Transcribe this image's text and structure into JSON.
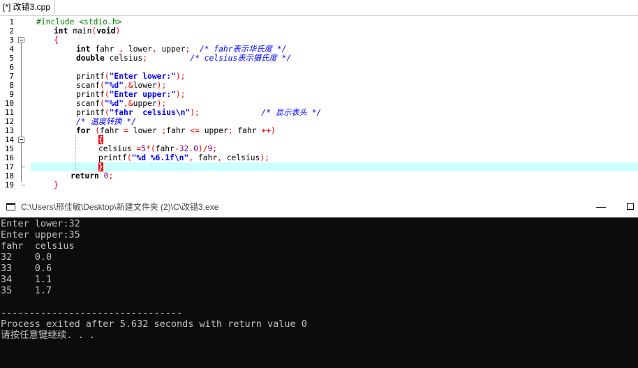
{
  "editor": {
    "tab_label": "[*] 改错3.cpp",
    "line_numbers": [
      "1",
      "2",
      "3",
      "4",
      "5",
      "6",
      "7",
      "8",
      "9",
      "10",
      "11",
      "12",
      "13",
      "14",
      "15",
      "16",
      "17",
      "18",
      "19"
    ],
    "code": {
      "l1": "#include <stdio.h>",
      "l2_kw": "int",
      "l2_rest": " main",
      "l2_p1": "(",
      "l2_void": "void",
      "l2_p2": ")",
      "l3": "{",
      "l4_kw": "int",
      "l4_rest": " fahr ",
      "l4_c1": ",",
      "l4_mid": " lower",
      "l4_c2": ",",
      "l4_end": " upper",
      "l4_semi": ";",
      "l4_comment": "  /* fahr表示华氏度 */",
      "l5_kw": "double",
      "l5_rest": " celsius",
      "l5_semi": ";",
      "l5_comment": "         /* celsius表示摄氏度 */",
      "l7_fn": "printf",
      "l7_p1": "(",
      "l7_str": "\"Enter lower:\"",
      "l7_p2": ");",
      "l8_fn": "scanf",
      "l8_p1": "(",
      "l8_str": "\"%d\"",
      "l8_rest": ",&",
      "l8_var": "lower",
      "l8_p2": ");",
      "l9_fn": "printf",
      "l9_p1": "(",
      "l9_str": "\"Enter upper:\"",
      "l9_p2": ");",
      "l10_fn": "scanf",
      "l10_p1": "(",
      "l10_str": "\"%d\"",
      "l10_rest": ",&",
      "l10_var": "upper",
      "l10_p2": ");",
      "l11_fn": "printf",
      "l11_p1": "(",
      "l11_str": "\"fahr  celsius\\n\"",
      "l11_p2": ");",
      "l11_comment": "             /* 显示表头 */",
      "l12_comment": "/* 温度转换 */",
      "l13_kw": "for",
      "l13_p1": " (",
      "l13_a": "fahr ",
      "l13_eq": "=",
      "l13_b": " lower ",
      "l13_s1": ";",
      "l13_c": "fahr ",
      "l13_le": "<=",
      "l13_d": " upper",
      "l13_s2": ";",
      "l13_e": " fahr ",
      "l13_pp": "++",
      "l13_p2": ")",
      "l14": "{",
      "l15_a": "celsius ",
      "l15_eq": "=",
      "l15_five": "5",
      "l15_mul": "*",
      "l15_p1": "(",
      "l15_b": "fahr",
      "l15_minus": "-",
      "l15_num": "32.0",
      "l15_p2": ")",
      "l15_div": "/",
      "l15_nine": "9",
      "l15_semi": ";",
      "l16_fn": "printf",
      "l16_p1": "(",
      "l16_str": "\"%d %6.1f\\n\"",
      "l16_c1": ",",
      "l16_a": " fahr",
      "l16_c2": ",",
      "l16_b": " celsius",
      "l16_p2": ");",
      "l17": "}",
      "l18_kw": "return",
      "l18_sp": " ",
      "l18_num": "0",
      "l18_semi": ";",
      "l19": "}"
    }
  },
  "console": {
    "title": "C:\\Users\\邢佳敏\\Desktop\\新建文件夹 (2)\\C\\改错3.exe",
    "minimize_glyph": "—",
    "lines": [
      "Enter lower:32",
      "Enter upper:35",
      "fahr  celsius",
      "32    0.0",
      "33    0.6",
      "34    1.1",
      "35    1.7",
      "",
      "--------------------------------",
      "Process exited after 5.632 seconds with return value 0",
      "请按任意键继续. . ."
    ]
  },
  "colors": {
    "keyword": "#000000",
    "comment": "#0000ff",
    "string": "#0000ff",
    "number": "#800080",
    "operator": "#ff0000",
    "preprocessor": "#008000",
    "current_line": "#ccffff",
    "console_bg": "#0c0c0c",
    "console_fg": "#c0c0c0"
  }
}
